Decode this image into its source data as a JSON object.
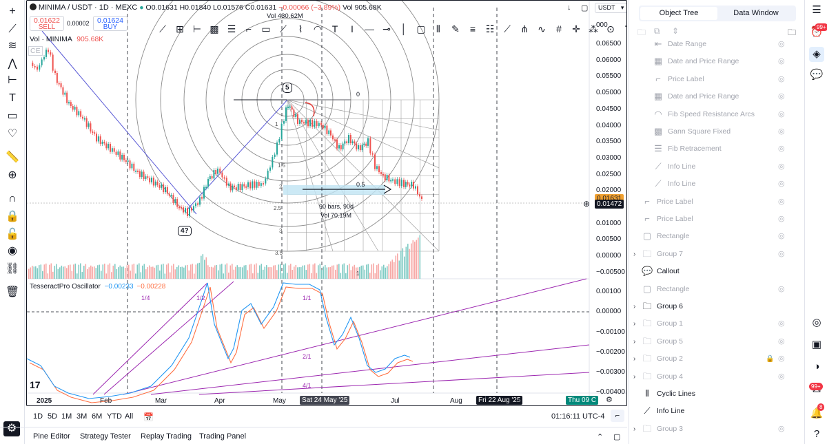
{
  "symbol": {
    "title": "MINIMA / USDT · 1D · MEXC",
    "ohlc": {
      "o": "O0.01631",
      "h": "H0.01840",
      "l": "L0.01576",
      "c": "C0.01631",
      "chg": "−0.00066 (−3.89%)"
    },
    "vol": "Vol 905.68K",
    "sell_price": "0.01622",
    "sell_label": "SELL",
    "spread": "0.00002",
    "buy_price": "0.01624",
    "buy_label": "BUY",
    "vol_legend": "Vol · MINIMA",
    "vol_value": "905.68K",
    "currency": "USDT",
    "left_tag": "CE"
  },
  "osc": {
    "name": "TesseractPro Oscillator",
    "v1": "−0.00233",
    "v2": "−0.00228"
  },
  "price_axis": [
    "0.06500",
    "0.06000",
    "0.05500",
    "0.05000",
    "0.04500",
    "0.04000",
    "0.03500",
    "0.03000",
    "0.02500",
    "0.02000",
    "0.01500",
    "0.01000",
    "0.00500",
    "0.00000",
    "−0.00500"
  ],
  "price_axis_top": "000",
  "price_tags": {
    "current": "0.01631",
    "crosshair": "0.01472"
  },
  "osc_axis": [
    "0.00100",
    "0.00000",
    "−0.00100",
    "−0.00200",
    "−0.00300",
    "−0.00400"
  ],
  "time_axis": [
    "2025",
    "Feb",
    "Mar",
    "Apr",
    "May",
    "Jul",
    "Aug"
  ],
  "time_tags": {
    "crosshair": "Sat 24 May '25",
    "vline": "Fri 22 Aug '25",
    "right": "Thu 09 C",
    "partial": "5"
  },
  "annotations": {
    "callout_5": "5",
    "callout_4": "4?",
    "zero": "0",
    "bars": "90 bars, 90d",
    "bars_vol": "Vol 70.19M",
    "vol_top": "Vol 430.62M",
    "fib_05": "0.5",
    "fib_one": "1",
    "fan_labels": [
      "1/4",
      "1/2",
      "1/1",
      "2/1",
      "4/1"
    ],
    "speed_labels": [
      "1",
      "1.5",
      "2",
      "2.5",
      "3",
      "3.5"
    ]
  },
  "timeframes": [
    "1D",
    "5D",
    "1M",
    "3M",
    "6M",
    "YTD",
    "All"
  ],
  "clock": "01:16:11 UTC-4",
  "bottom_tabs": [
    "Pine Editor",
    "Strategy Tester",
    "Replay Trading",
    "Trading Panel"
  ],
  "panel_tabs": [
    "Object Tree",
    "Data Window"
  ],
  "tree": [
    {
      "label": "Date Range",
      "icon": "date-range-icon",
      "glyph": "⇤",
      "dim": true,
      "indent": 1,
      "eye": true
    },
    {
      "label": "Date and Price Range",
      "icon": "date-price-range-icon",
      "glyph": "▦",
      "dim": true,
      "indent": 1,
      "eye": true
    },
    {
      "label": "Price Label",
      "icon": "price-label-icon",
      "glyph": "⌐",
      "dim": true,
      "indent": 1,
      "eye": true
    },
    {
      "label": "Date and Price Range",
      "icon": "date-price-range-icon",
      "glyph": "▦",
      "dim": true,
      "indent": 1,
      "eye": true
    },
    {
      "label": "Fib Speed Resistance Arcs",
      "icon": "fib-arcs-icon",
      "glyph": "◠",
      "dim": true,
      "indent": 1,
      "eye": true
    },
    {
      "label": "Gann Square Fixed",
      "icon": "gann-square-icon",
      "glyph": "▩",
      "dim": true,
      "indent": 1,
      "eye": true
    },
    {
      "label": "Fib Retracement",
      "icon": "fib-retracement-icon",
      "glyph": "☰",
      "dim": true,
      "indent": 1,
      "eye": true
    },
    {
      "label": "Info Line",
      "icon": "info-line-icon",
      "glyph": "⟋",
      "dim": true,
      "indent": 1,
      "eye": true
    },
    {
      "label": "Info Line",
      "icon": "info-line-icon",
      "glyph": "⟋",
      "dim": true,
      "indent": 1,
      "eye": true
    },
    {
      "label": "Price Label",
      "icon": "price-label-icon",
      "glyph": "⌐",
      "dim": true,
      "indent": 0,
      "eye": true
    },
    {
      "label": "Price Label",
      "icon": "price-label-icon",
      "glyph": "⌐",
      "dim": true,
      "indent": 0,
      "eye": true
    },
    {
      "label": "Rectangle",
      "icon": "rectangle-icon",
      "glyph": "▢",
      "dim": true,
      "indent": 0,
      "eye": true
    },
    {
      "label": "Group 7",
      "icon": "folder-icon",
      "glyph": "🗀",
      "dim": true,
      "indent": 0,
      "eye": true,
      "arrow": true
    },
    {
      "label": "Callout",
      "icon": "callout-icon",
      "glyph": "💬",
      "dim": false,
      "indent": 0,
      "eye": false
    },
    {
      "label": "Rectangle",
      "icon": "rectangle-icon",
      "glyph": "▢",
      "dim": true,
      "indent": 0,
      "eye": true
    },
    {
      "label": "Group 6",
      "icon": "folder-icon",
      "glyph": "🗀",
      "dim": false,
      "indent": 0,
      "eye": false,
      "arrow": true
    },
    {
      "label": "Group 1",
      "icon": "folder-icon",
      "glyph": "🗀",
      "dim": true,
      "indent": 0,
      "eye": true,
      "arrow": true
    },
    {
      "label": "Group 5",
      "icon": "folder-icon",
      "glyph": "🗀",
      "dim": true,
      "indent": 0,
      "eye": true,
      "arrow": true
    },
    {
      "label": "Group 2",
      "icon": "folder-icon",
      "glyph": "🗀",
      "dim": true,
      "indent": 0,
      "eye": true,
      "arrow": true,
      "lock": true
    },
    {
      "label": "Group 4",
      "icon": "folder-icon",
      "glyph": "🗀",
      "dim": true,
      "indent": 0,
      "eye": true,
      "arrow": true
    },
    {
      "label": "Cyclic Lines",
      "icon": "cyclic-lines-icon",
      "glyph": "⦀",
      "dim": false,
      "indent": 0,
      "eye": false
    },
    {
      "label": "Info Line",
      "icon": "info-line-icon",
      "glyph": "⟋",
      "dim": false,
      "indent": 0,
      "eye": false
    },
    {
      "label": "Group 3",
      "icon": "folder-icon",
      "glyph": "🗀",
      "dim": true,
      "indent": 0,
      "eye": true,
      "arrow": true
    }
  ],
  "badges": {
    "b1": "99+",
    "b2": "99+",
    "b3": "8"
  },
  "colors": {
    "up": "#26a69a",
    "down": "#ef5350",
    "fan": "#9c27b0",
    "osc_blue": "#2196f3",
    "osc_orange": "#ff7043",
    "gann": "#9e9e9e",
    "trend": "#5b5bd6"
  }
}
